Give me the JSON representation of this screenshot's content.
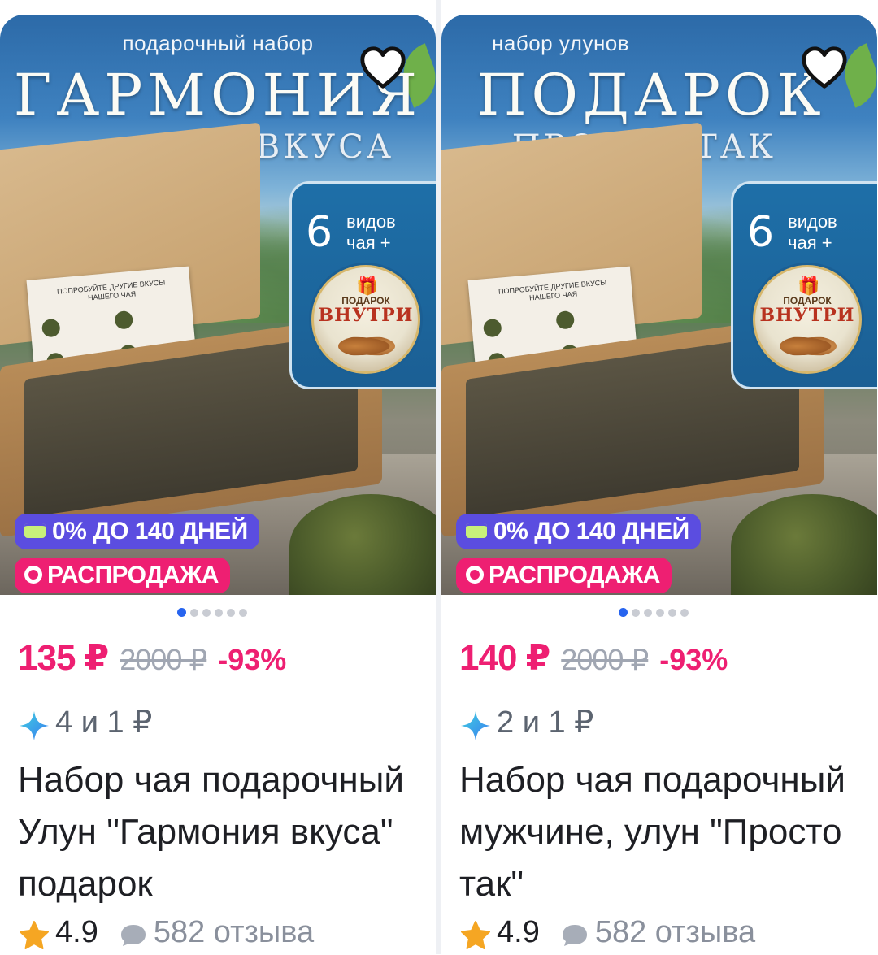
{
  "products": [
    {
      "image": {
        "subtitle": "подарочный набор",
        "title": "ГАРМОНИЯ",
        "title_small": "ВКУСА",
        "count": "6",
        "count_label_1": "видов",
        "count_label_2": "чая +",
        "gift_top": "ПОДАРОК",
        "gift_main": "ВНУТРИ",
        "sheet_heading": "ПОПРОБУЙТЕ ДРУГИЕ ВКУСЫ НАШЕГО ЧАЯ"
      },
      "badges": {
        "installment": "0% ДО 140 ДНЕЙ",
        "sale": "РАСПРОДАЖА"
      },
      "carousel": {
        "total": 6,
        "active": 0
      },
      "price": "135 ₽",
      "old_price": "2000 ₽",
      "discount": "-93%",
      "bonus": "4 и 1 ₽",
      "title": "Набор чая подарочный Улун \"Гармония вкуса\" подарок",
      "rating": "4.9",
      "reviews": "582 отзыва",
      "icons": {
        "favorite": "heart-icon",
        "bonus": "sparkle-icon",
        "rating": "star-icon",
        "reviews": "chat-bubble-icon"
      }
    },
    {
      "image": {
        "subtitle": "набор улунов",
        "title": "ПОДАРОК",
        "title_small": "ПРОСТО ТАК",
        "count": "6",
        "count_label_1": "видов",
        "count_label_2": "чая +",
        "gift_top": "ПОДАРОК",
        "gift_main": "ВНУТРИ",
        "sheet_heading": "ПОПРОБУЙТЕ ДРУГИЕ ВКУСЫ НАШЕГО ЧАЯ"
      },
      "badges": {
        "installment": "0% ДО 140 ДНЕЙ",
        "sale": "РАСПРОДАЖА"
      },
      "carousel": {
        "total": 6,
        "active": 0
      },
      "price": "140 ₽",
      "old_price": "2000 ₽",
      "discount": "-93%",
      "bonus": "2 и 1 ₽",
      "title": "Набор чая подарочный мужчине, улун \"Просто так\"",
      "rating": "4.9",
      "reviews": "582 отзыва",
      "icons": {
        "favorite": "heart-icon",
        "bonus": "sparkle-icon",
        "rating": "star-icon",
        "reviews": "chat-bubble-icon"
      }
    }
  ],
  "colors": {
    "price": "#ee1f72",
    "installment_badge": "#5b4de0",
    "sale_badge": "#ee1f72",
    "carousel_active": "#2764ef",
    "rating_star": "#f5a623"
  }
}
